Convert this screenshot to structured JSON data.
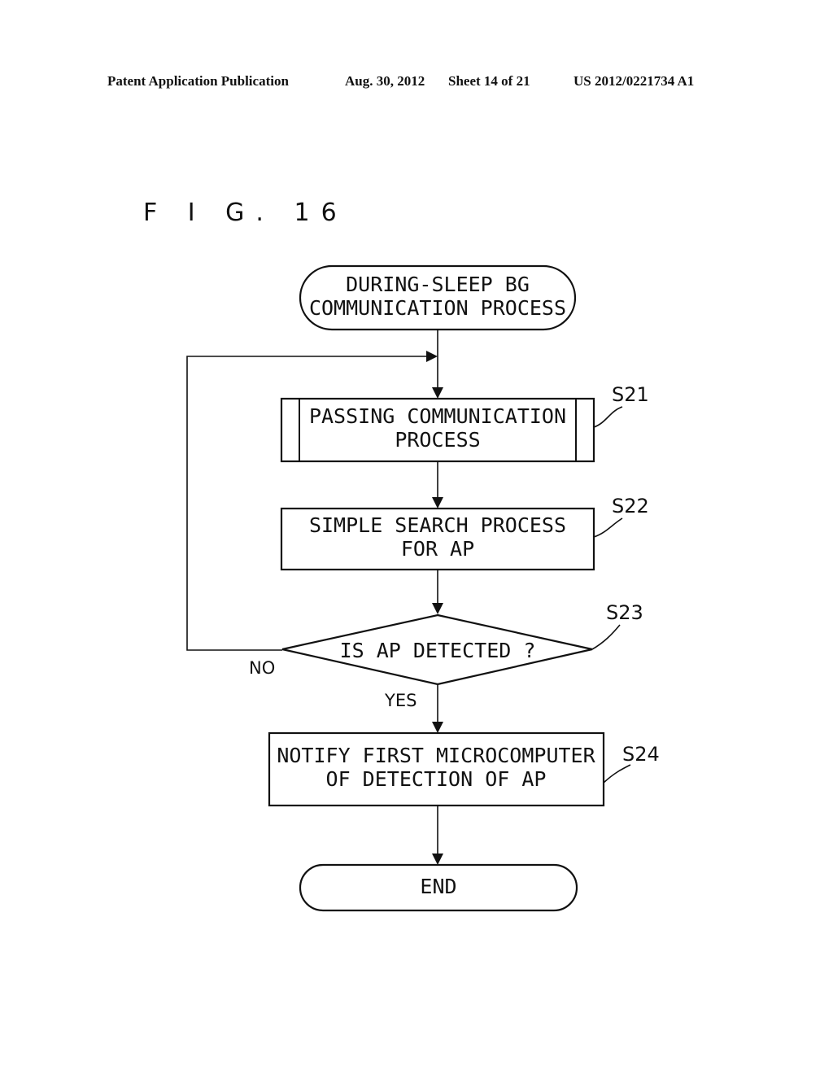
{
  "header": {
    "publication": "Patent Application Publication",
    "date": "Aug. 30, 2012",
    "sheet": "Sheet 14 of 21",
    "number": "US 2012/0221734 A1"
  },
  "figure": {
    "title": "F I G. 16"
  },
  "flowchart": {
    "start": {
      "lines": [
        "DURING-SLEEP BG",
        "COMMUNICATION PROCESS"
      ]
    },
    "steps": [
      {
        "id": "S21",
        "type": "predefined-process",
        "lines": [
          "PASSING COMMUNICATION",
          "PROCESS"
        ]
      },
      {
        "id": "S22",
        "type": "process",
        "lines": [
          "SIMPLE SEARCH PROCESS",
          "FOR AP"
        ]
      },
      {
        "id": "S23",
        "type": "decision",
        "lines": [
          "IS AP DETECTED ?"
        ],
        "no_label": "NO",
        "yes_label": "YES"
      },
      {
        "id": "S24",
        "type": "process",
        "lines": [
          "NOTIFY FIRST MICROCOMPUTER",
          "OF DETECTION OF AP"
        ]
      }
    ],
    "end": {
      "lines": [
        "END"
      ]
    }
  }
}
